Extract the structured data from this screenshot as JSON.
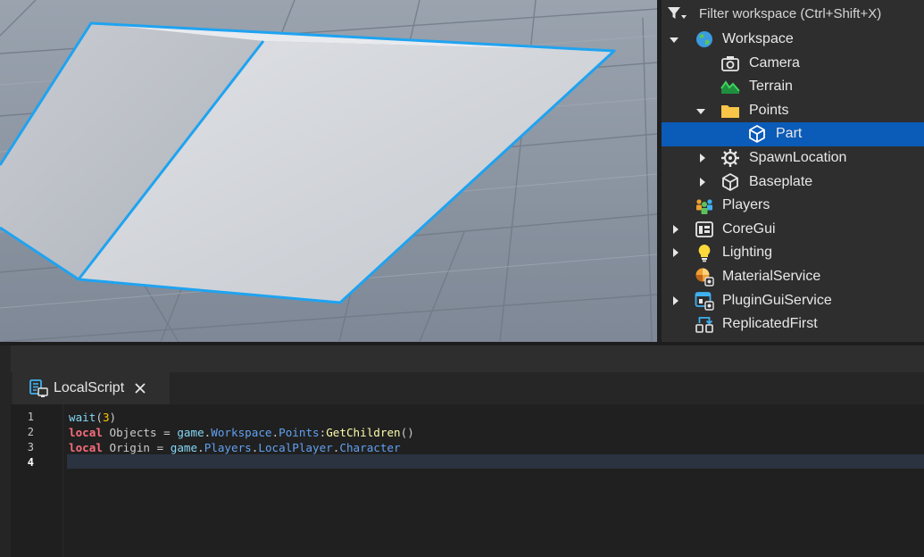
{
  "explorer": {
    "filter_placeholder": "Filter workspace (Ctrl+Shift+X)",
    "items": [
      {
        "label": "Workspace",
        "icon": "workspace-globe-icon",
        "expanded": true
      },
      {
        "label": "Camera",
        "icon": "camera-icon"
      },
      {
        "label": "Terrain",
        "icon": "terrain-icon"
      },
      {
        "label": "Points",
        "icon": "folder-icon",
        "expanded": true
      },
      {
        "label": "Part",
        "icon": "part-cube-icon",
        "selected": true
      },
      {
        "label": "SpawnLocation",
        "icon": "spawn-gear-icon",
        "expanded": false
      },
      {
        "label": "Baseplate",
        "icon": "part-cube-icon",
        "expanded": false
      },
      {
        "label": "Players",
        "icon": "players-icon"
      },
      {
        "label": "CoreGui",
        "icon": "coregui-icon",
        "expanded": false
      },
      {
        "label": "Lighting",
        "icon": "lightbulb-icon",
        "expanded": false
      },
      {
        "label": "MaterialService",
        "icon": "material-service-icon"
      },
      {
        "label": "PluginGuiService",
        "icon": "plugin-gui-icon",
        "expanded": false
      },
      {
        "label": "ReplicatedFirst",
        "icon": "replicated-first-icon"
      }
    ]
  },
  "editor": {
    "tab_label": "LocalScript",
    "line_numbers": [
      "1",
      "2",
      "3",
      "4"
    ],
    "lines": [
      [
        {
          "t": "wait",
          "c": "bi"
        },
        {
          "t": "(",
          "c": ""
        },
        {
          "t": "3",
          "c": "num"
        },
        {
          "t": ")",
          "c": ""
        }
      ],
      [
        {
          "t": "local",
          "c": "kw"
        },
        {
          "t": " Objects = ",
          "c": ""
        },
        {
          "t": "game",
          "c": "bi"
        },
        {
          "t": ".",
          "c": ""
        },
        {
          "t": "Workspace",
          "c": "prop"
        },
        {
          "t": ".",
          "c": ""
        },
        {
          "t": "Points",
          "c": "prop"
        },
        {
          "t": ":",
          "c": ""
        },
        {
          "t": "GetChildren",
          "c": "fn"
        },
        {
          "t": "()",
          "c": ""
        }
      ],
      [
        {
          "t": "local",
          "c": "kw"
        },
        {
          "t": " Origin = ",
          "c": ""
        },
        {
          "t": "game",
          "c": "bi"
        },
        {
          "t": ".",
          "c": ""
        },
        {
          "t": "Players",
          "c": "prop"
        },
        {
          "t": ".",
          "c": ""
        },
        {
          "t": "LocalPlayer",
          "c": "prop"
        },
        {
          "t": ".",
          "c": ""
        },
        {
          "t": "Character",
          "c": "prop"
        }
      ],
      []
    ],
    "active_line": "4"
  },
  "colors": {
    "selection_blue": "#0b5bb8",
    "outline_blue": "#1fa3f0",
    "keyword": "#f86d7c",
    "builtin": "#84d6f7",
    "property": "#61a1f1",
    "function": "#fdfbac",
    "number": "#ffc600"
  }
}
